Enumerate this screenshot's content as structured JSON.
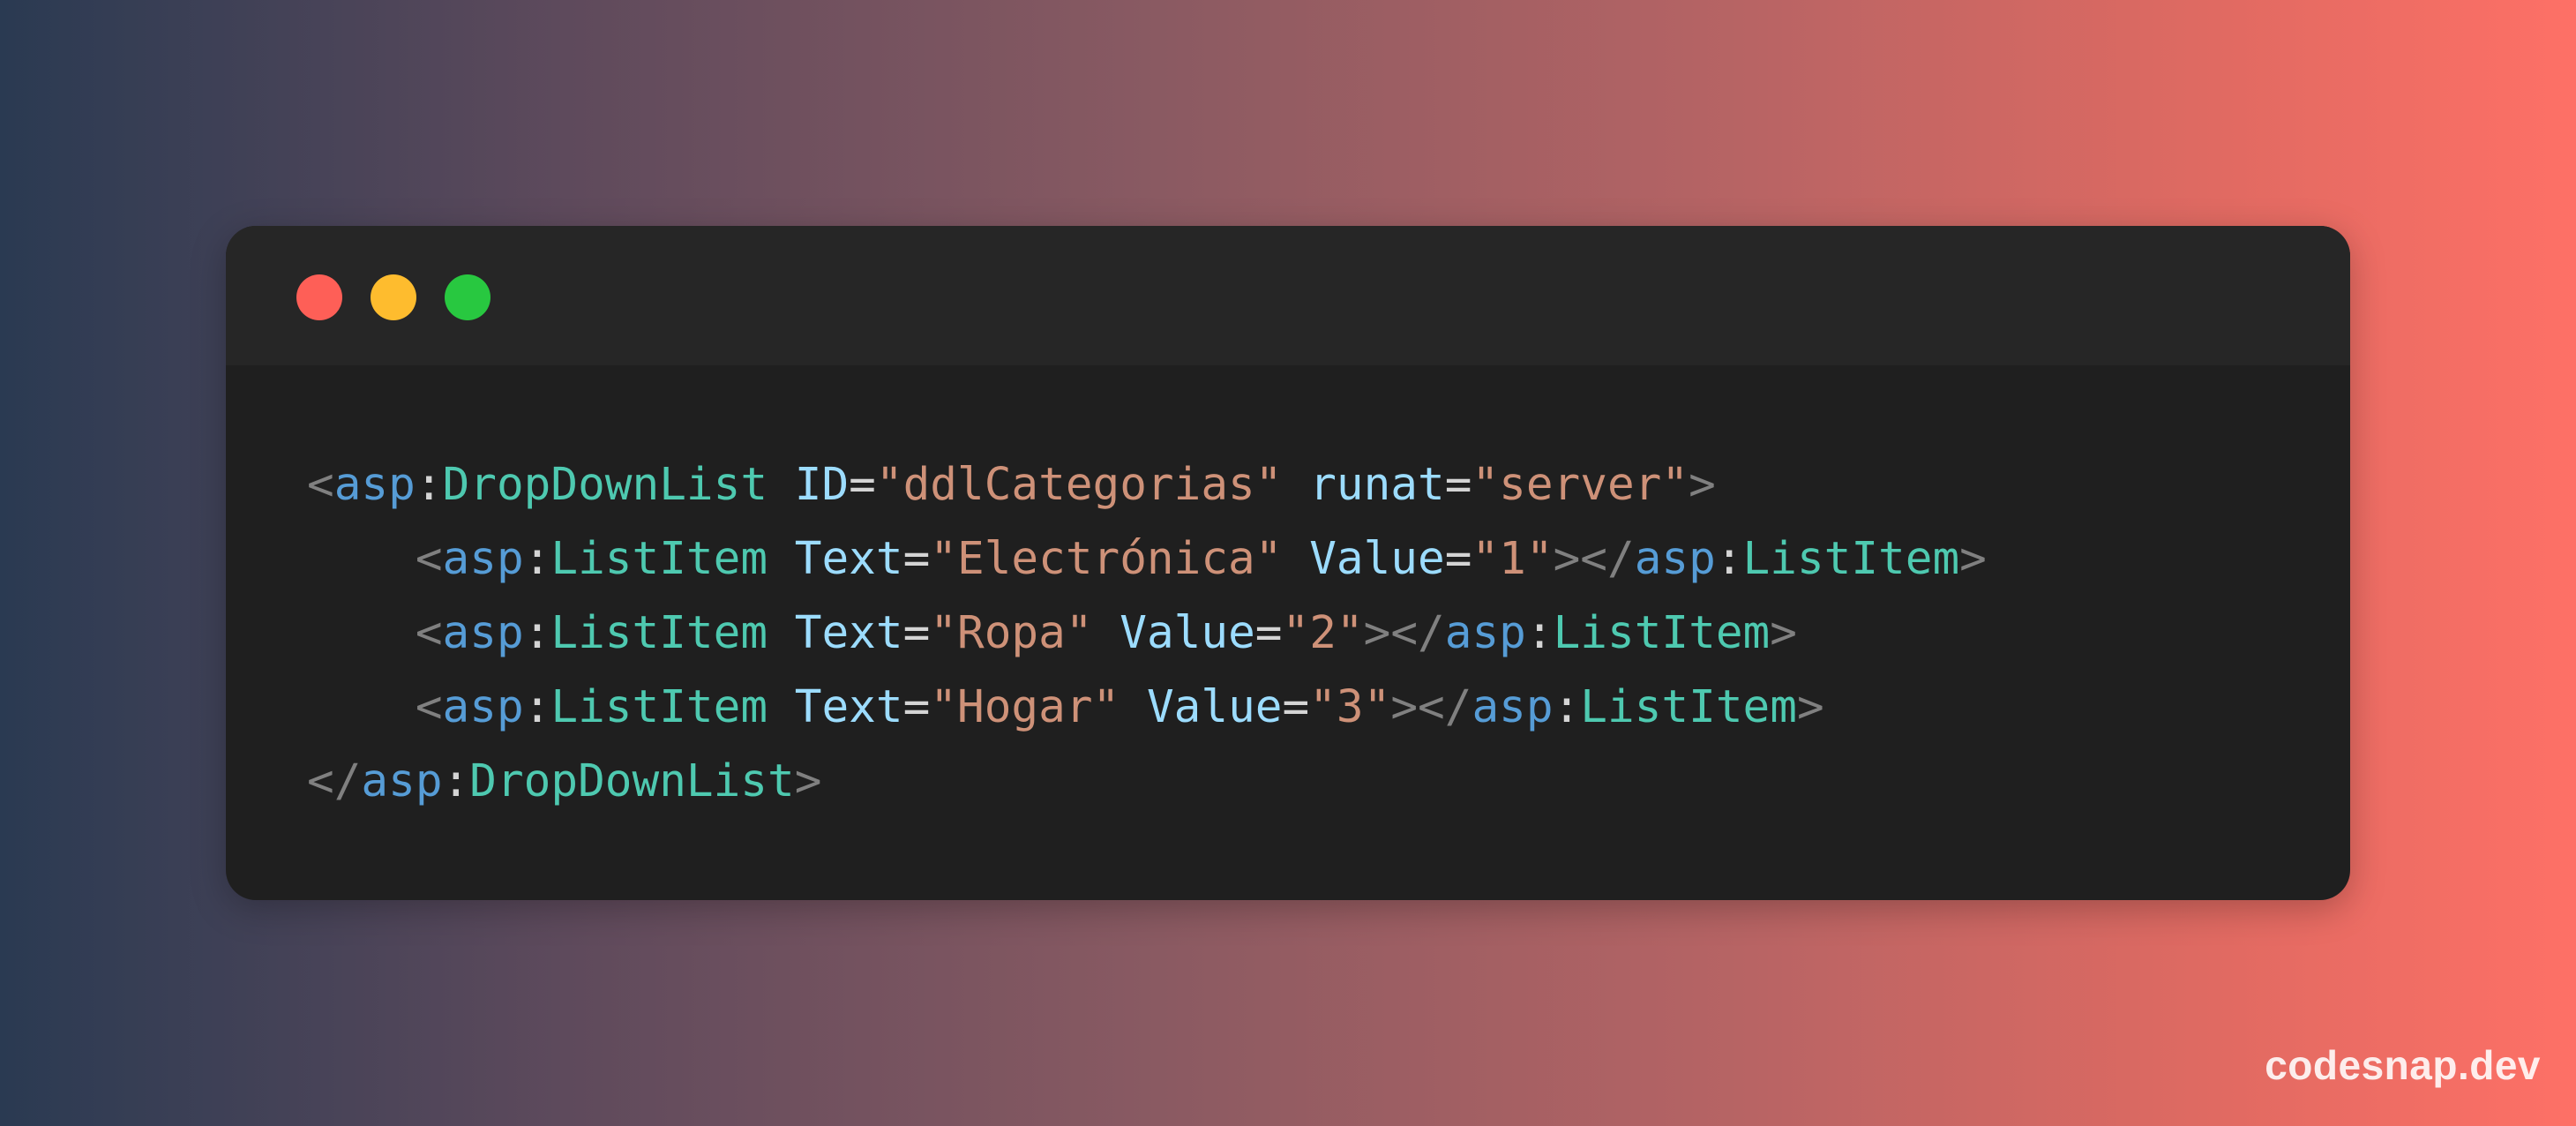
{
  "window": {
    "controls": [
      {
        "name": "close",
        "color": "#fe5f57"
      },
      {
        "name": "minimize",
        "color": "#febc2e"
      },
      {
        "name": "maximize",
        "color": "#28c840"
      }
    ]
  },
  "code": {
    "language": "aspx",
    "lines": [
      [
        {
          "t": "punct",
          "v": "<"
        },
        {
          "t": "ns",
          "v": "asp"
        },
        {
          "t": "colon",
          "v": ":"
        },
        {
          "t": "tag",
          "v": "DropDownList"
        },
        {
          "t": "ws",
          "v": " "
        },
        {
          "t": "attr",
          "v": "ID"
        },
        {
          "t": "eq",
          "v": "="
        },
        {
          "t": "str",
          "v": "\"ddlCategorias\""
        },
        {
          "t": "ws",
          "v": " "
        },
        {
          "t": "attr",
          "v": "runat"
        },
        {
          "t": "eq",
          "v": "="
        },
        {
          "t": "str",
          "v": "\"server\""
        },
        {
          "t": "punct",
          "v": ">"
        }
      ],
      [
        {
          "t": "ws",
          "v": "    "
        },
        {
          "t": "punct",
          "v": "<"
        },
        {
          "t": "ns",
          "v": "asp"
        },
        {
          "t": "colon",
          "v": ":"
        },
        {
          "t": "tag",
          "v": "ListItem"
        },
        {
          "t": "ws",
          "v": " "
        },
        {
          "t": "attr",
          "v": "Text"
        },
        {
          "t": "eq",
          "v": "="
        },
        {
          "t": "str",
          "v": "\"Electrónica\""
        },
        {
          "t": "ws",
          "v": " "
        },
        {
          "t": "attr",
          "v": "Value"
        },
        {
          "t": "eq",
          "v": "="
        },
        {
          "t": "str",
          "v": "\"1\""
        },
        {
          "t": "punct",
          "v": "></"
        },
        {
          "t": "ns",
          "v": "asp"
        },
        {
          "t": "colon",
          "v": ":"
        },
        {
          "t": "tag",
          "v": "ListItem"
        },
        {
          "t": "punct",
          "v": ">"
        }
      ],
      [
        {
          "t": "ws",
          "v": "    "
        },
        {
          "t": "punct",
          "v": "<"
        },
        {
          "t": "ns",
          "v": "asp"
        },
        {
          "t": "colon",
          "v": ":"
        },
        {
          "t": "tag",
          "v": "ListItem"
        },
        {
          "t": "ws",
          "v": " "
        },
        {
          "t": "attr",
          "v": "Text"
        },
        {
          "t": "eq",
          "v": "="
        },
        {
          "t": "str",
          "v": "\"Ropa\""
        },
        {
          "t": "ws",
          "v": " "
        },
        {
          "t": "attr",
          "v": "Value"
        },
        {
          "t": "eq",
          "v": "="
        },
        {
          "t": "str",
          "v": "\"2\""
        },
        {
          "t": "punct",
          "v": "></"
        },
        {
          "t": "ns",
          "v": "asp"
        },
        {
          "t": "colon",
          "v": ":"
        },
        {
          "t": "tag",
          "v": "ListItem"
        },
        {
          "t": "punct",
          "v": ">"
        }
      ],
      [
        {
          "t": "ws",
          "v": "    "
        },
        {
          "t": "punct",
          "v": "<"
        },
        {
          "t": "ns",
          "v": "asp"
        },
        {
          "t": "colon",
          "v": ":"
        },
        {
          "t": "tag",
          "v": "ListItem"
        },
        {
          "t": "ws",
          "v": " "
        },
        {
          "t": "attr",
          "v": "Text"
        },
        {
          "t": "eq",
          "v": "="
        },
        {
          "t": "str",
          "v": "\"Hogar\""
        },
        {
          "t": "ws",
          "v": " "
        },
        {
          "t": "attr",
          "v": "Value"
        },
        {
          "t": "eq",
          "v": "="
        },
        {
          "t": "str",
          "v": "\"3\""
        },
        {
          "t": "punct",
          "v": "></"
        },
        {
          "t": "ns",
          "v": "asp"
        },
        {
          "t": "colon",
          "v": ":"
        },
        {
          "t": "tag",
          "v": "ListItem"
        },
        {
          "t": "punct",
          "v": ">"
        }
      ],
      [
        {
          "t": "punct",
          "v": "</"
        },
        {
          "t": "ns",
          "v": "asp"
        },
        {
          "t": "colon",
          "v": ":"
        },
        {
          "t": "tag",
          "v": "DropDownList"
        },
        {
          "t": "punct",
          "v": ">"
        }
      ]
    ]
  },
  "colors": {
    "punct": "#808080",
    "ns": "#569cd6",
    "tag": "#4ec9b0",
    "attr": "#9cdcfe",
    "str": "#ce9178",
    "text": "#d4d4d4"
  },
  "watermark": {
    "text": "codesnap.dev"
  }
}
